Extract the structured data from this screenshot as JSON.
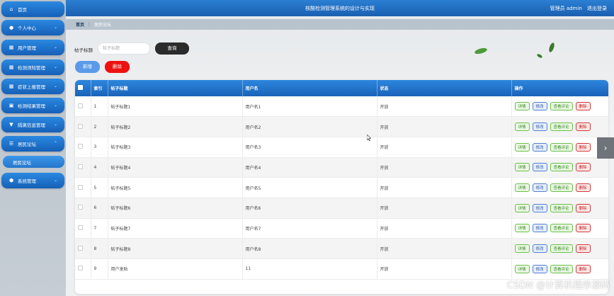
{
  "app": {
    "title": "核酸检测管理系统的设计与实现",
    "user_label": "管理员 admin",
    "logout_label": "退出登录"
  },
  "sidebar": {
    "items": [
      {
        "label": "首页",
        "icon": "home-icon"
      },
      {
        "label": "个人中心",
        "icon": "user-icon"
      },
      {
        "label": "用户管理",
        "icon": "grid-icon"
      },
      {
        "label": "检测须知管理",
        "icon": "grid-icon"
      },
      {
        "label": "症状上报管理",
        "icon": "grid-icon"
      },
      {
        "label": "检测结果管理",
        "icon": "clipboard-icon"
      },
      {
        "label": "隔离信息管理",
        "icon": "bookmark-icon"
      },
      {
        "label": "居民论坛",
        "icon": "sliders-icon"
      },
      {
        "label": "系统管理",
        "icon": "shield-icon"
      }
    ],
    "sub_item": "居民论坛"
  },
  "breadcrumb": {
    "home": "首页",
    "current": "居民论坛"
  },
  "search": {
    "label": "帖子标题",
    "placeholder": "帖子标题",
    "query_button": "查询"
  },
  "actions": {
    "add": "新增",
    "delete": "删除"
  },
  "table": {
    "headers": [
      "索引",
      "帖子标题",
      "用户名",
      "状态",
      "操作"
    ],
    "rows": [
      {
        "index": "1",
        "title": "帖子标题1",
        "username": "用户名1",
        "status": "开放"
      },
      {
        "index": "2",
        "title": "帖子标题2",
        "username": "用户名2",
        "status": "开放"
      },
      {
        "index": "3",
        "title": "帖子标题3",
        "username": "用户名3",
        "status": "开放"
      },
      {
        "index": "4",
        "title": "帖子标题4",
        "username": "用户名4",
        "status": "开放"
      },
      {
        "index": "5",
        "title": "帖子标题5",
        "username": "用户名5",
        "status": "开放"
      },
      {
        "index": "6",
        "title": "帖子标题6",
        "username": "用户名6",
        "status": "开放"
      },
      {
        "index": "7",
        "title": "帖子标题7",
        "username": "用户名7",
        "status": "开放"
      },
      {
        "index": "8",
        "title": "帖子标题8",
        "username": "用户名8",
        "status": "开放"
      },
      {
        "index": "9",
        "title": "用户发贴",
        "username": "11",
        "status": "开放"
      }
    ],
    "row_actions": {
      "detail": "详情",
      "edit": "修改",
      "comments": "查看评论",
      "delete": "删除"
    }
  },
  "watermark": "CSDN @计算机程序源码",
  "colors": {
    "primary": "#1a63b9",
    "delete": "#ee1111",
    "dark_button": "#2b2b2b"
  }
}
